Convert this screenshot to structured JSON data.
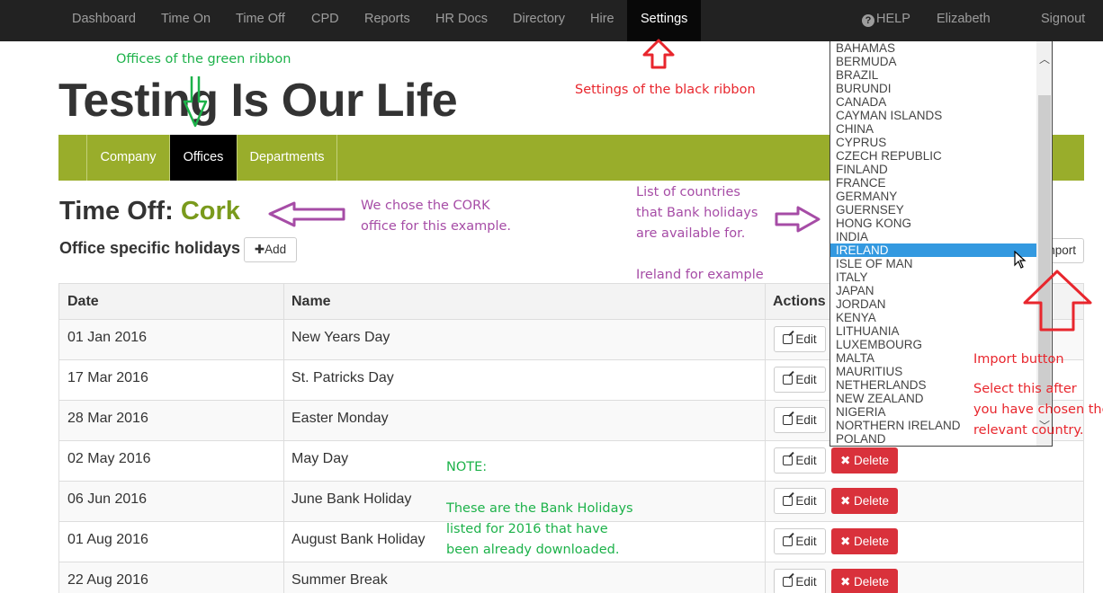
{
  "navbar": {
    "items": [
      "Dashboard",
      "Time On",
      "Time Off",
      "CPD",
      "Reports",
      "HR Docs",
      "Directory",
      "Hire",
      "Settings"
    ],
    "active": "Settings",
    "help_label": "HELP",
    "user_name": "Elizabeth",
    "signout_label": "Signout"
  },
  "org_title": "Testing Is Our Life",
  "ribbon": {
    "items": [
      "Company",
      "Offices",
      "Departments"
    ],
    "active": "Offices"
  },
  "section": {
    "prefix": "Time Off:",
    "office": "Cork"
  },
  "subsection": {
    "title": "Office specific holidays",
    "add_label": "Add",
    "import_label": "nport"
  },
  "table": {
    "headers": [
      "Date",
      "Name",
      "Actions"
    ],
    "edit_label": "Edit",
    "delete_label": "Delete",
    "rows": [
      {
        "date": "01 Jan 2016",
        "name": "New Years Day"
      },
      {
        "date": "17 Mar 2016",
        "name": "St. Patricks Day"
      },
      {
        "date": "28 Mar 2016",
        "name": "Easter Monday"
      },
      {
        "date": "02 May 2016",
        "name": "May Day"
      },
      {
        "date": "06 Jun 2016",
        "name": "June Bank Holiday"
      },
      {
        "date": "01 Aug 2016",
        "name": "August Bank Holiday"
      },
      {
        "date": "22 Aug 2016",
        "name": "Summer Break"
      }
    ]
  },
  "country_dropdown": {
    "options": [
      "BAHAMAS",
      "BERMUDA",
      "BRAZIL",
      "BURUNDI",
      "CANADA",
      "CAYMAN ISLANDS",
      "CHINA",
      "CYPRUS",
      "CZECH REPUBLIC",
      "FINLAND",
      "FRANCE",
      "GERMANY",
      "GUERNSEY",
      "HONG KONG",
      "INDIA",
      "IRELAND",
      "ISLE OF MAN",
      "ITALY",
      "JAPAN",
      "JORDAN",
      "KENYA",
      "LITHUANIA",
      "LUXEMBOURG",
      "MALTA",
      "MAURITIUS",
      "NETHERLANDS",
      "NEW ZEALAND",
      "NIGERIA",
      "NORTHERN IRELAND",
      "POLAND"
    ],
    "selected": "IRELAND"
  },
  "annotations": {
    "green_ribbon": "Offices of the green ribbon",
    "black_ribbon": "Settings of the black ribbon",
    "cork": [
      "We chose the CORK",
      "office for this example."
    ],
    "countries": [
      "List of countries",
      "that Bank holidays",
      "are available for."
    ],
    "ireland": "Ireland for example",
    "import_title": "Import button",
    "import_text": [
      "Select this after",
      "you have chosen the",
      "relevant country."
    ],
    "note_title": "NOTE:",
    "note_text": [
      "These are the Bank Holidays",
      "listed for 2016 that have",
      "been already downloaded."
    ]
  },
  "colors": {
    "navbar": "#222222",
    "ribbon": "#99ad2b",
    "office_name": "#7a9a1c",
    "delete": "#d9313b",
    "selected_option": "#3399e0",
    "annotation_green": "#1db24a",
    "annotation_red": "#e8262d",
    "annotation_purple": "#a64ca6"
  }
}
